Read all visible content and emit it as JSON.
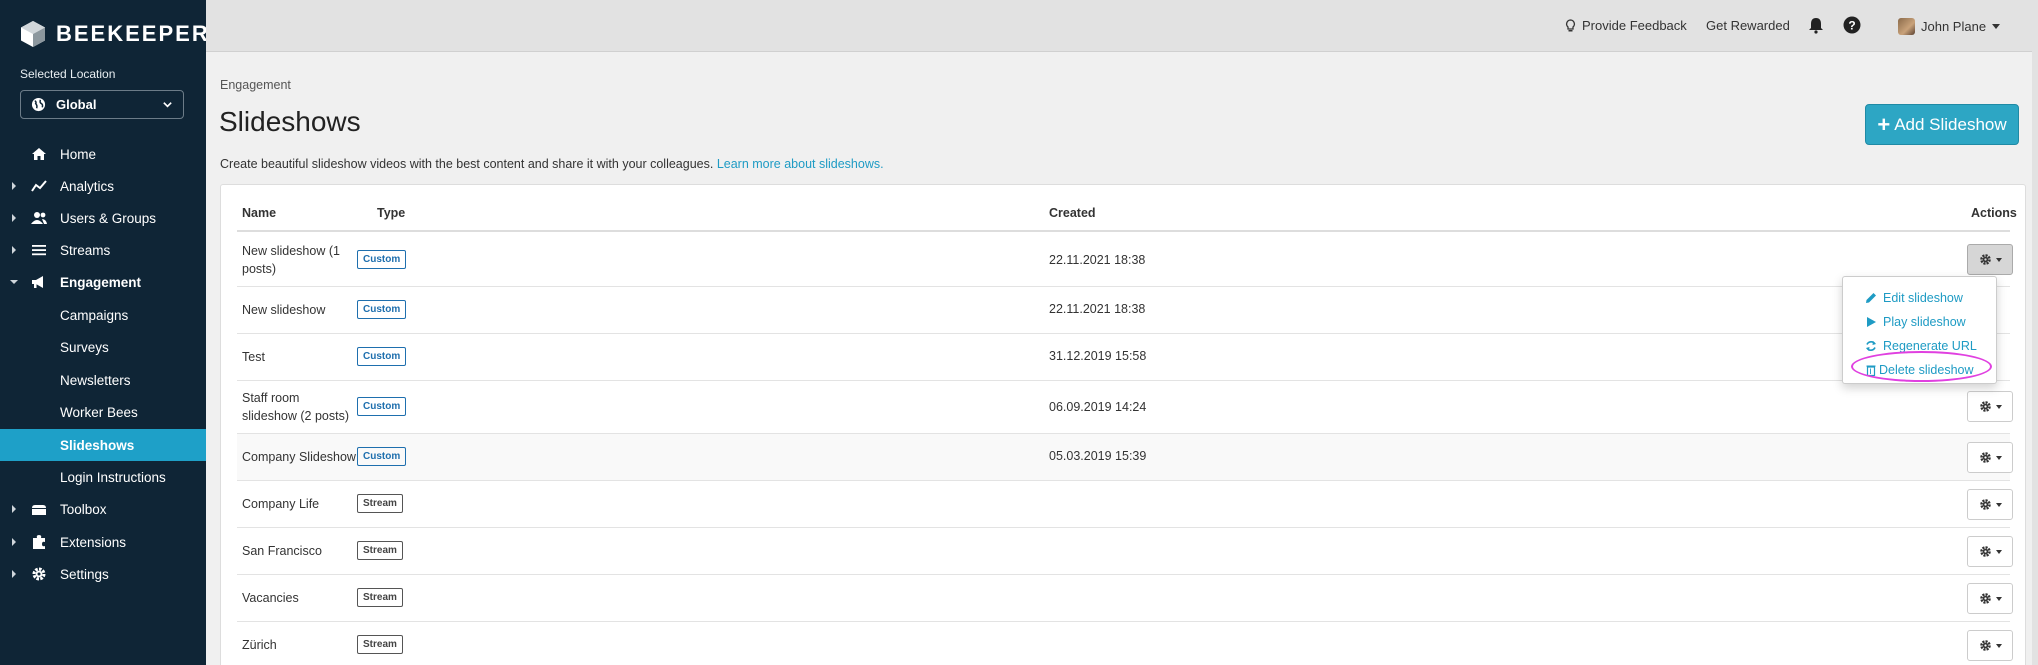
{
  "brand": {
    "name": "BEEKEEPER"
  },
  "location": {
    "label": "Selected Location",
    "value": "Global"
  },
  "nav": {
    "home": "Home",
    "analytics": "Analytics",
    "users": "Users & Groups",
    "streams": "Streams",
    "engagement": "Engagement",
    "campaigns": "Campaigns",
    "surveys": "Surveys",
    "newsletters": "Newsletters",
    "workerbees": "Worker Bees",
    "slideshows": "Slideshows",
    "login": "Login Instructions",
    "toolbox": "Toolbox",
    "extensions": "Extensions",
    "settings": "Settings"
  },
  "topbar": {
    "feedback": "Provide Feedback",
    "rewarded": "Get Rewarded",
    "user": "John Plane"
  },
  "page": {
    "breadcrumb": "Engagement",
    "title": "Slideshows",
    "description": "Create beautiful slideshow videos with the best content and share it with your colleagues.",
    "learn_more": "Learn more about slideshows.",
    "add_button": "Add Slideshow"
  },
  "table": {
    "headers": {
      "name": "Name",
      "type": "Type",
      "created": "Created",
      "actions": "Actions"
    },
    "rows": [
      {
        "name": "New slideshow (1 posts)",
        "type": "Custom",
        "created": "22.11.2021 18:38"
      },
      {
        "name": "New slideshow",
        "type": "Custom",
        "created": "22.11.2021 18:38"
      },
      {
        "name": "Test",
        "type": "Custom",
        "created": "31.12.2019 15:58"
      },
      {
        "name": "Staff room slideshow (2 posts)",
        "type": "Custom",
        "created": "06.09.2019 14:24"
      },
      {
        "name": "Company Slideshow",
        "type": "Custom",
        "created": "05.03.2019 15:39"
      },
      {
        "name": "Company Life",
        "type": "Stream",
        "created": ""
      },
      {
        "name": "San Francisco",
        "type": "Stream",
        "created": ""
      },
      {
        "name": "Vacancies",
        "type": "Stream",
        "created": ""
      },
      {
        "name": "Zürich",
        "type": "Stream",
        "created": ""
      }
    ]
  },
  "actions_menu": {
    "edit": "Edit slideshow",
    "play": "Play slideshow",
    "regenerate": "Regenerate URL",
    "delete": "Delete slideshow"
  },
  "colors": {
    "sidebar": "#0f2536",
    "accent": "#1ea0c8",
    "highlight": "#e040e0"
  }
}
